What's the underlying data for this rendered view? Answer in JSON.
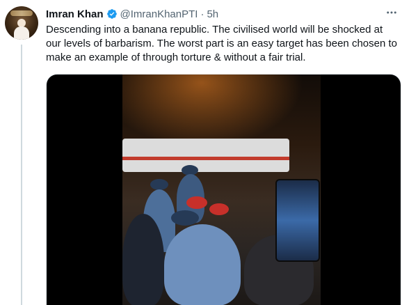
{
  "tweet": {
    "author_name": "Imran Khan",
    "handle": "@ImranKhanPTI",
    "separator": "·",
    "time": "5h",
    "more_icon": "more-horizontal-icon",
    "verified_icon": "verified-badge-icon",
    "text": "Descending into a banana republic. The civilised world will be shocked at\nour levels of barbarism. The worst part is an easy target has been chosen to\nmake an example of through torture & without a fair trial."
  },
  "colors": {
    "verified": "#1d9bf0",
    "secondary_text": "#536471",
    "primary_text": "#0f1419"
  }
}
